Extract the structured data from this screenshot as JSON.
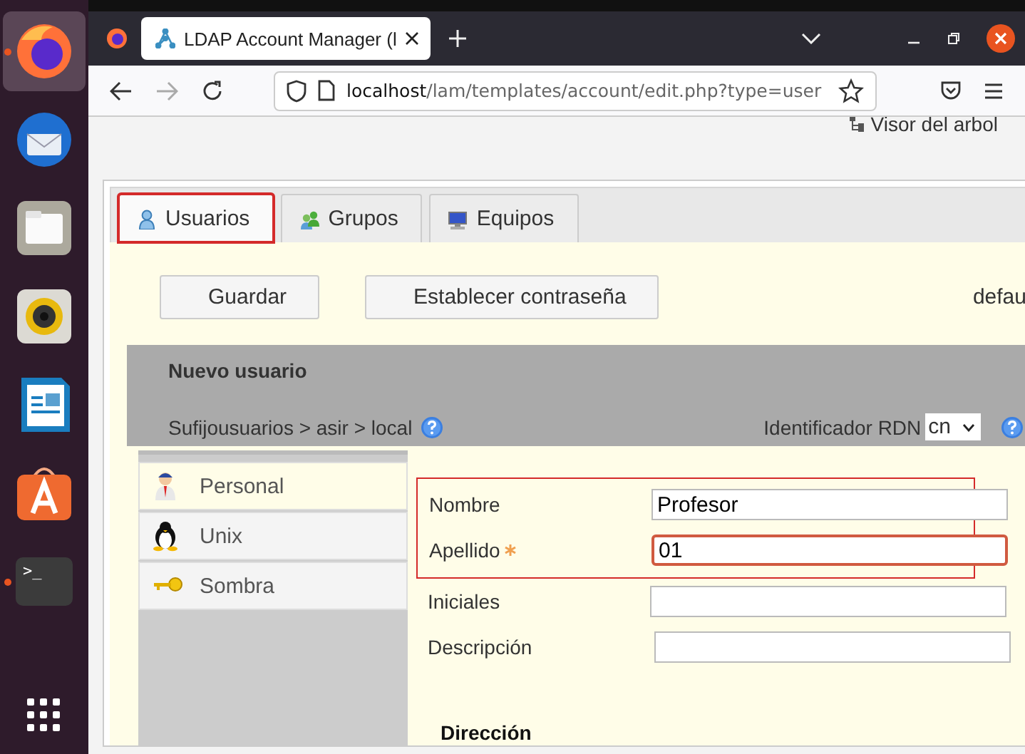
{
  "dock": {
    "items": [
      {
        "kind": "firefox",
        "active": true,
        "running": true
      },
      {
        "kind": "mail",
        "active": false,
        "running": false
      },
      {
        "kind": "files",
        "active": false,
        "running": false
      },
      {
        "kind": "music",
        "active": false,
        "running": false
      },
      {
        "kind": "writer",
        "active": false,
        "running": false
      },
      {
        "kind": "store",
        "active": false,
        "running": false
      },
      {
        "kind": "terminal",
        "active": false,
        "running": true,
        "label": ">_"
      }
    ]
  },
  "browser": {
    "tabs": [
      {
        "title": "LDAP Account Manager (l",
        "selected": true
      }
    ],
    "url": {
      "host": "localhost",
      "path": "/lam/templates/account/edit.php?type=user"
    }
  },
  "page": {
    "tree_view_link": "Visor del arbol",
    "account_tabs": [
      {
        "label": "Usuarios",
        "kind": "user",
        "selected": true,
        "highlighted": true
      },
      {
        "label": "Grupos",
        "kind": "group",
        "selected": false,
        "highlighted": false
      },
      {
        "label": "Equipos",
        "kind": "computer",
        "selected": false,
        "highlighted": false
      }
    ],
    "buttons": [
      "Guardar",
      "Establecer contraseña"
    ],
    "profile_text": "defau",
    "panel": {
      "title": "Nuevo usuario",
      "suffix": "Sufijousuarios > asir > local",
      "rdn_label": "Identificador RDN",
      "rdn_value": "cn"
    },
    "modules": [
      {
        "label": "Personal",
        "kind": "person",
        "selected": true
      },
      {
        "label": "Unix",
        "kind": "penguin",
        "selected": false
      },
      {
        "label": "Sombra",
        "kind": "key",
        "selected": false
      }
    ],
    "fields": [
      {
        "label": "Nombre",
        "value": "Profesor",
        "required": false,
        "focused": false,
        "highlighted": true
      },
      {
        "label": "Apellido",
        "value": "01",
        "required": true,
        "focused": true,
        "highlighted": true
      },
      {
        "label": "Iniciales",
        "required": false,
        "focused": false,
        "highlighted": false
      },
      {
        "label": "Descripción",
        "required": false,
        "focused": false,
        "highlighted": false
      }
    ],
    "section_title": "Dirección"
  }
}
